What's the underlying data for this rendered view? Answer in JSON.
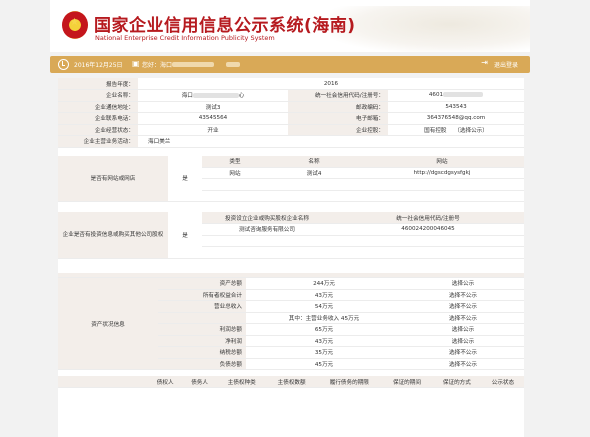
{
  "header": {
    "title_cn": "国家企业信用信息公示系统(海南)",
    "title_en": "National Enterprise Credit Information Publicity System"
  },
  "topbar": {
    "date": "2016年12月25日",
    "welcome": "您好：海口",
    "logout": "退出登录"
  },
  "basic": {
    "report_year_label": "报告年度：",
    "report_year": "2016",
    "company_name_label": "企业名称：",
    "company_name_prefix": "海口",
    "company_name_suffix": "心",
    "credit_code_label": "统一社会信用代码/注册号：",
    "credit_code_prefix": "4601",
    "address_label": "企业通信地址：",
    "address": "测试3",
    "postcode_label": "邮政编码：",
    "postcode": "543543",
    "phone_label": "企业联系电话：",
    "phone": "43545564",
    "email_label": "电子邮箱：",
    "email": "364376548@qq.com",
    "status_label": "企业经营状态：",
    "status": "开业",
    "holding_label": "企业控股：",
    "holding": "国有控股",
    "holding_note": "（选择公示）",
    "business_label": "企业主营业务活动：",
    "business": "海口美兰"
  },
  "website": {
    "section_label": "是否有网站或网店",
    "answer": "是",
    "headers": [
      "类型",
      "名称",
      "网站"
    ],
    "rows": [
      [
        "网站",
        "测试4",
        "http://dgscdgsysfgkj"
      ]
    ]
  },
  "investment": {
    "section_label": "企业是否有投资信息或购买其他公司股权",
    "answer": "是",
    "headers": [
      "投资设立企业或购买股权企业名称",
      "统一社会信用代码/注册号"
    ],
    "rows": [
      [
        "测试咨询服务有限公司",
        "460024200046045"
      ]
    ]
  },
  "assets": {
    "section_label": "资产状况信息",
    "rows": [
      {
        "label": "资产总额",
        "value": "244万元",
        "note": "选择公示"
      },
      {
        "label": "所有者权益合计",
        "value": "43万元",
        "note": "选择不公示"
      },
      {
        "label": "营业总收入",
        "value": "54万元",
        "note": "选择不公示"
      },
      {
        "label": "",
        "value": "其中：主营业务收入 45万元",
        "note": "选择不公示"
      },
      {
        "label": "利润总额",
        "value": "65万元",
        "note": "选择公示"
      },
      {
        "label": "净利润",
        "value": "43万元",
        "note": "选择公示"
      },
      {
        "label": "纳税总额",
        "value": "35万元",
        "note": "选择不公示"
      },
      {
        "label": "负债总额",
        "value": "45万元",
        "note": "选择不公示"
      }
    ]
  },
  "guarantee": {
    "headers": [
      "债权人",
      "债务人",
      "主债权种类",
      "主债权数额",
      "履行债务的期限",
      "保证的期间",
      "保证的方式",
      "公示状态"
    ]
  }
}
